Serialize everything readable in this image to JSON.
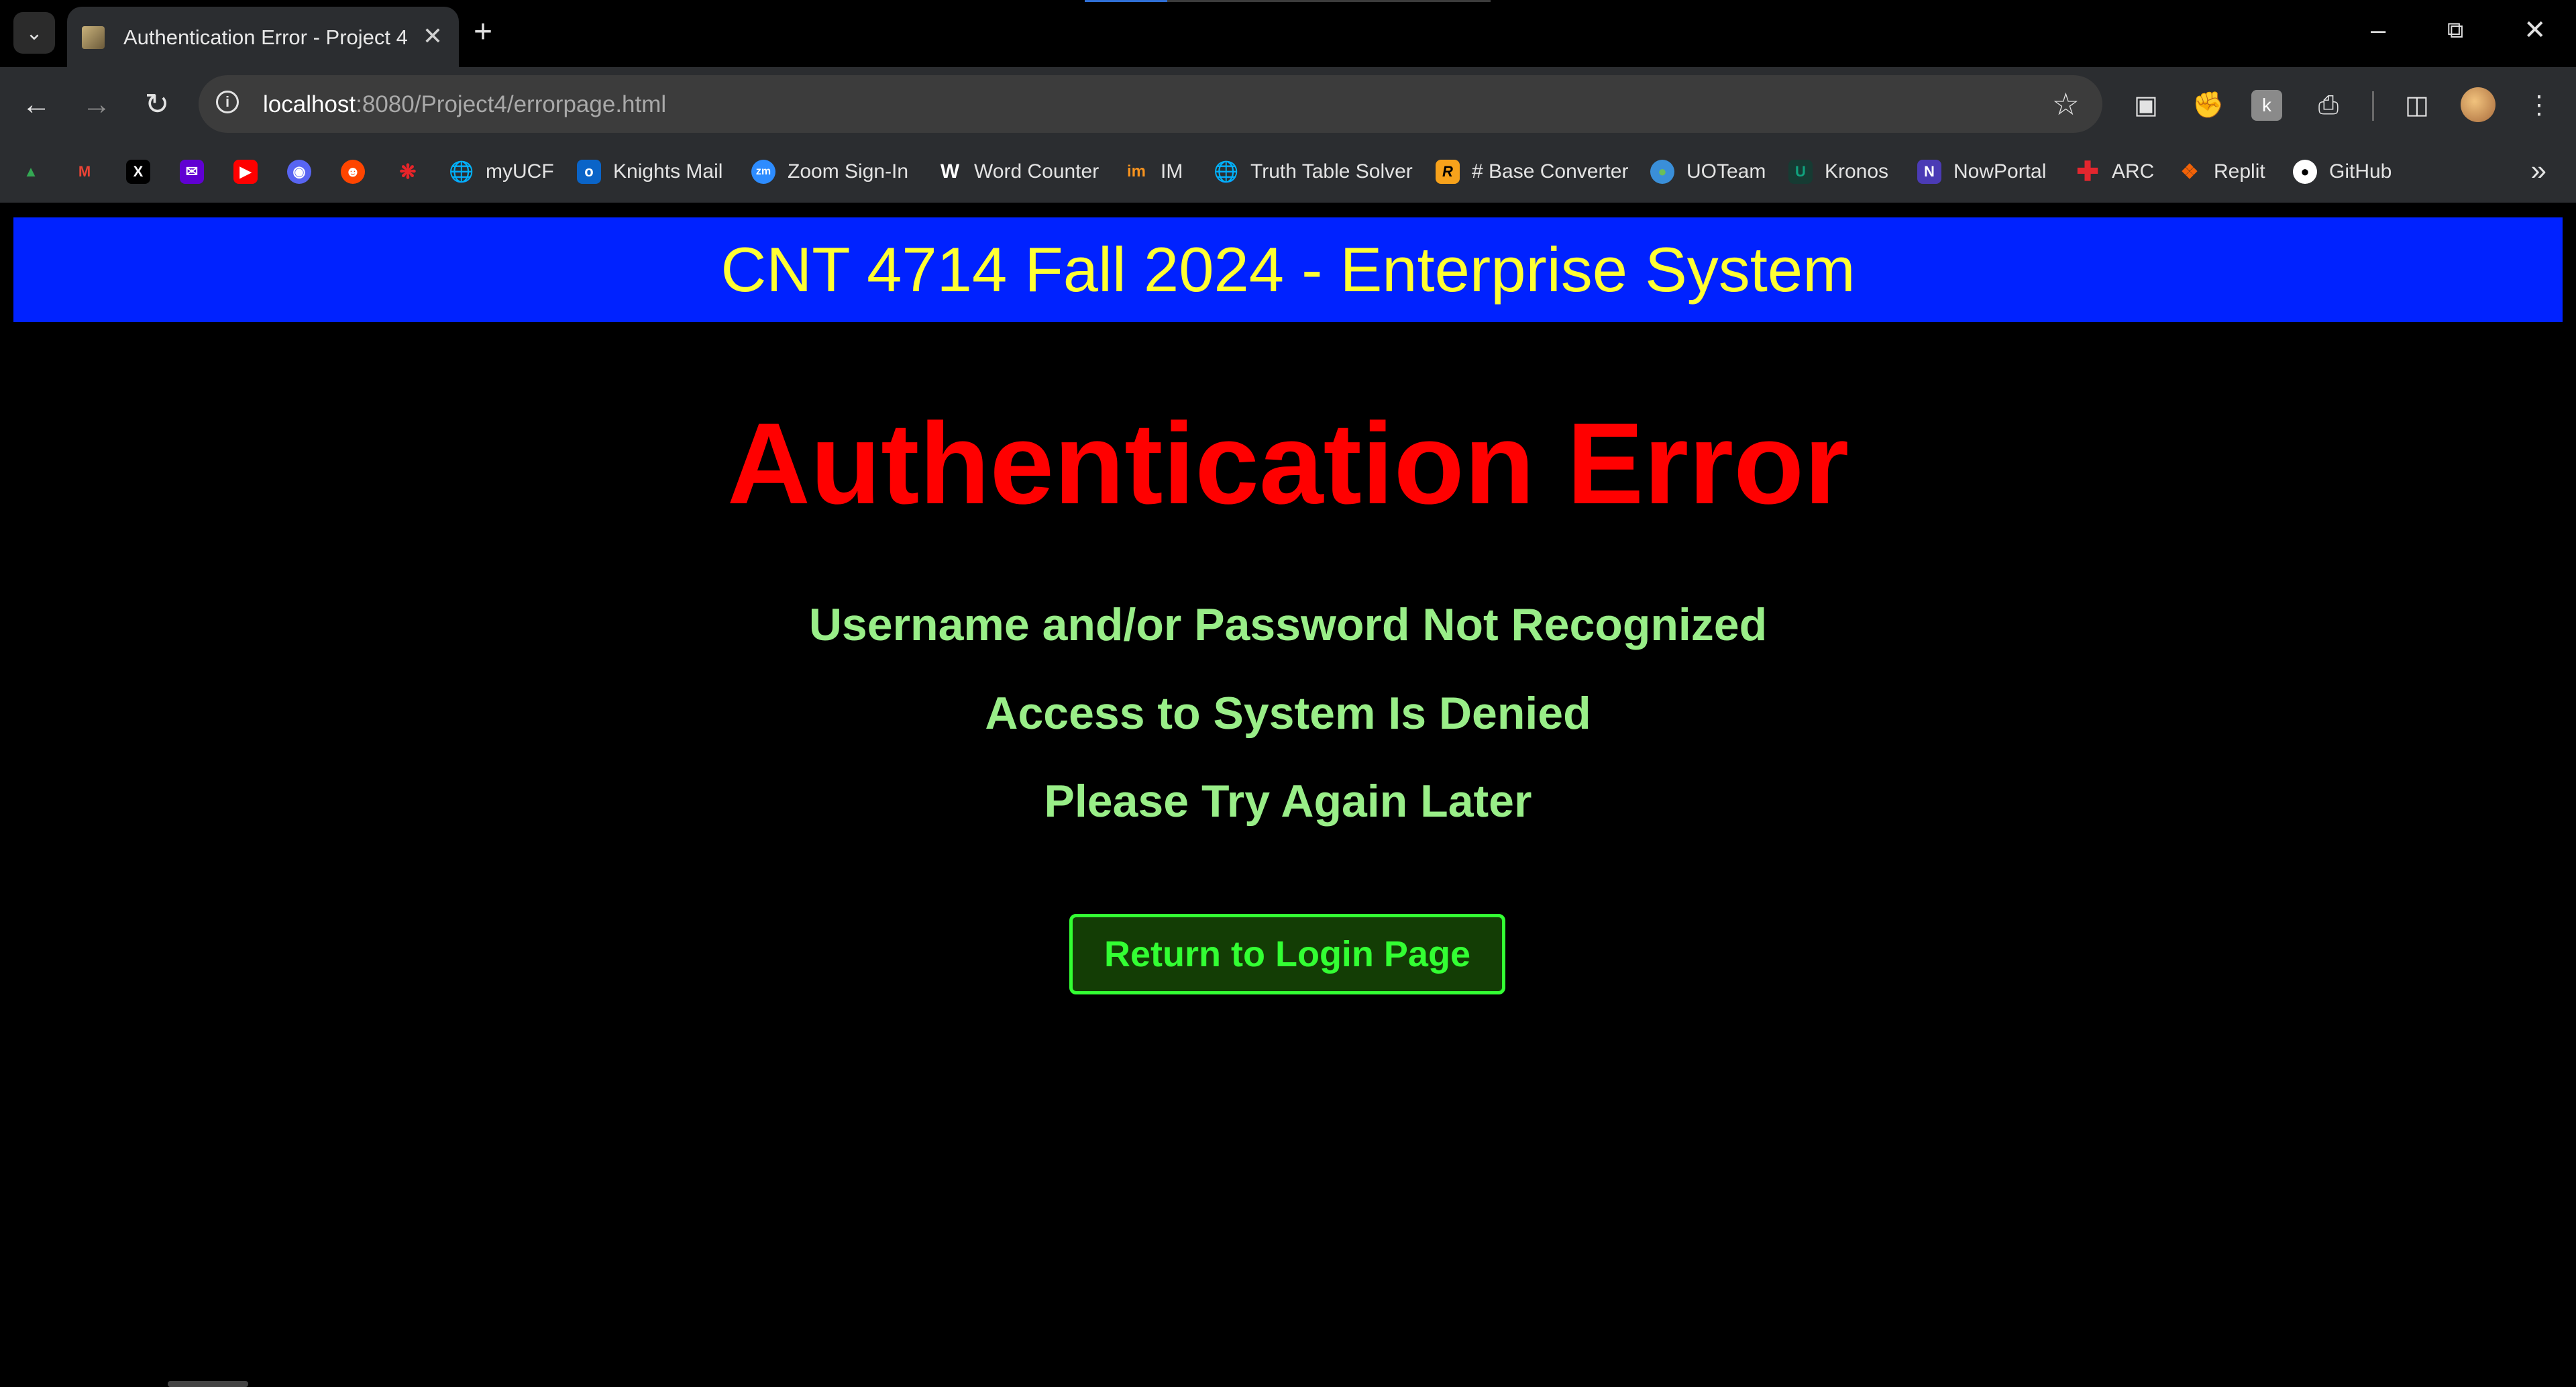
{
  "browser": {
    "tab": {
      "title": "Authentication Error - Project 4"
    },
    "url": {
      "host": "localhost",
      "path": ":8080/Project4/errorpage.html"
    },
    "bookmarks": [
      {
        "label": "",
        "icon": "google-drive-icon",
        "color": "#34a853"
      },
      {
        "label": "",
        "icon": "gmail-icon",
        "color": "#ea4335"
      },
      {
        "label": "",
        "icon": "x-icon",
        "color": "#000000"
      },
      {
        "label": "",
        "icon": "yahoo-mail-icon",
        "color": "#6001d2"
      },
      {
        "label": "",
        "icon": "youtube-icon",
        "color": "#ff0000"
      },
      {
        "label": "",
        "icon": "discord-icon",
        "color": "#5865f2"
      },
      {
        "label": "",
        "icon": "reddit-icon",
        "color": "#ff4500"
      },
      {
        "label": "",
        "icon": "canvas-icon",
        "color": "#e72429"
      },
      {
        "label": "myUCF",
        "icon": "globe-icon",
        "color": "#5f6368"
      },
      {
        "label": "Knights Mail",
        "icon": "outlook-icon",
        "color": "#0a64c8"
      },
      {
        "label": "Zoom Sign-In",
        "icon": "zoom-icon",
        "color": "#2d8cff"
      },
      {
        "label": "Word Counter",
        "icon": "word-counter-icon",
        "color": "#000000"
      },
      {
        "label": "IM",
        "icon": "im-icon",
        "color": "#f7931e"
      },
      {
        "label": "Truth Table Solver",
        "icon": "globe-icon",
        "color": "#5f6368"
      },
      {
        "label": "# Base Converter",
        "icon": "base-converter-icon",
        "color": "#f7a21b"
      },
      {
        "label": "UOTeam",
        "icon": "earth-icon",
        "color": "#3a8fd9"
      },
      {
        "label": "Kronos",
        "icon": "kronos-icon",
        "color": "#10a37f"
      },
      {
        "label": "NowPortal",
        "icon": "nowportal-icon",
        "color": "#4b3bb5"
      },
      {
        "label": "ARC",
        "icon": "red-cross-icon",
        "color": "#e3262e"
      },
      {
        "label": "Replit",
        "icon": "replit-icon",
        "color": "#f26207"
      },
      {
        "label": "GitHub",
        "icon": "github-icon",
        "color": "#ffffff"
      }
    ]
  },
  "page": {
    "banner_title": "CNT 4714 Fall 2024 - Enterprise System",
    "error_title": "Authentication Error",
    "messages": [
      "Username and/or Password Not Recognized",
      "Access to System Is Denied",
      "Please Try Again Later"
    ],
    "return_button": "Return to Login Page"
  },
  "colors": {
    "banner_bg": "#0022ff",
    "banner_text": "#ffff33",
    "error_title": "#ff0000",
    "message_text": "#99ee88",
    "button_text": "#33ff33",
    "button_bg": "#133d05"
  }
}
